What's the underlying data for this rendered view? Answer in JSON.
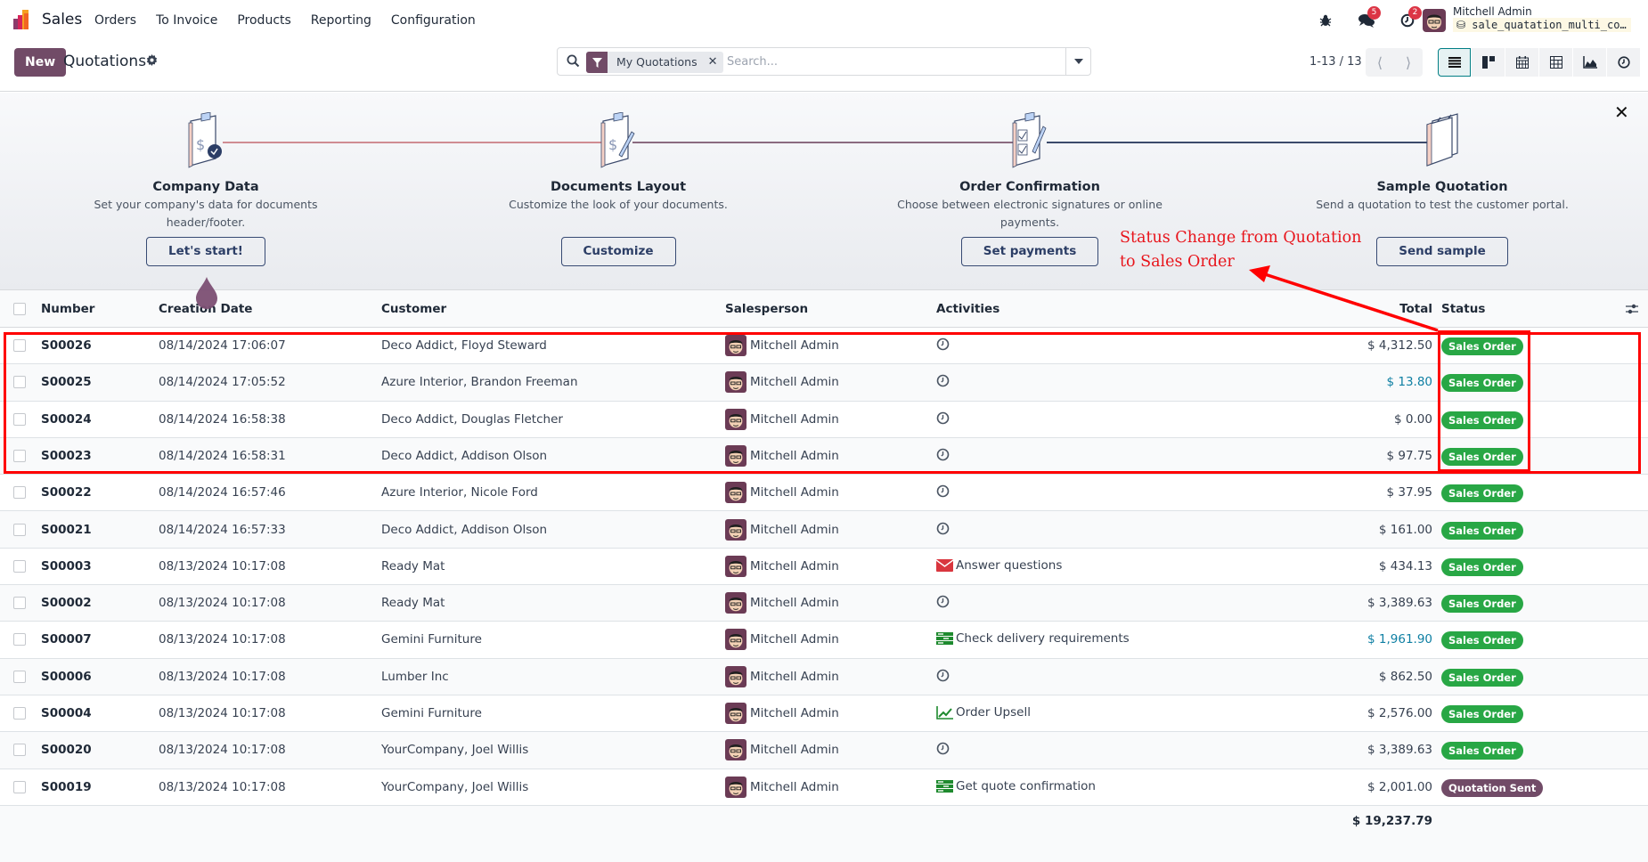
{
  "navbar": {
    "app_name": "Sales",
    "menu": [
      "Orders",
      "To Invoice",
      "Products",
      "Reporting",
      "Configuration"
    ],
    "messages_count": "5",
    "activities_count": "2",
    "user_name": "Mitchell Admin",
    "database": "sale_quatation_multi_con…"
  },
  "control": {
    "new_label": "New",
    "title": "Quotations",
    "facet_label": "My Quotations",
    "search_placeholder": "Search...",
    "pager": "1-13 / 13",
    "views": [
      "list-view",
      "kanban-view",
      "calendar-view",
      "pivot-view",
      "graph-view",
      "activity-view"
    ],
    "active_view": "list-view"
  },
  "banner": {
    "steps": [
      {
        "title": "Company Data",
        "desc": "Set your company's data for documents header/footer.",
        "button": "Let's start!"
      },
      {
        "title": "Documents Layout",
        "desc": "Customize the look of your documents.",
        "button": "Customize"
      },
      {
        "title": "Order Confirmation",
        "desc": "Choose between electronic signatures or online payments.",
        "button": "Set payments"
      },
      {
        "title": "Sample Quotation",
        "desc": "Send a quotation to test the customer portal.",
        "button": "Send sample"
      }
    ]
  },
  "table": {
    "columns": [
      "Number",
      "Creation Date",
      "Customer",
      "Salesperson",
      "Activities",
      "Total",
      "Status"
    ],
    "rows": [
      {
        "number": "S00026",
        "date": "08/14/2024 17:06:07",
        "customer": "Deco Addict, Floyd Steward",
        "salesperson": "Mitchell Admin",
        "activity": "",
        "activity_icon": "clock-icon",
        "total": "$ 4,312.50",
        "total_highlight": false,
        "status": "Sales Order"
      },
      {
        "number": "S00025",
        "date": "08/14/2024 17:05:52",
        "customer": "Azure Interior, Brandon Freeman",
        "salesperson": "Mitchell Admin",
        "activity": "",
        "activity_icon": "clock-icon",
        "total": "$ 13.80",
        "total_highlight": true,
        "status": "Sales Order"
      },
      {
        "number": "S00024",
        "date": "08/14/2024 16:58:38",
        "customer": "Deco Addict, Douglas Fletcher",
        "salesperson": "Mitchell Admin",
        "activity": "",
        "activity_icon": "clock-icon",
        "total": "$ 0.00",
        "total_highlight": false,
        "status": "Sales Order"
      },
      {
        "number": "S00023",
        "date": "08/14/2024 16:58:31",
        "customer": "Deco Addict, Addison Olson",
        "salesperson": "Mitchell Admin",
        "activity": "",
        "activity_icon": "clock-icon",
        "total": "$ 97.75",
        "total_highlight": false,
        "status": "Sales Order"
      },
      {
        "number": "S00022",
        "date": "08/14/2024 16:57:46",
        "customer": "Azure Interior, Nicole Ford",
        "salesperson": "Mitchell Admin",
        "activity": "",
        "activity_icon": "clock-icon",
        "total": "$ 37.95",
        "total_highlight": false,
        "status": "Sales Order"
      },
      {
        "number": "S00021",
        "date": "08/14/2024 16:57:33",
        "customer": "Deco Addict, Addison Olson",
        "salesperson": "Mitchell Admin",
        "activity": "",
        "activity_icon": "clock-icon",
        "total": "$ 161.00",
        "total_highlight": false,
        "status": "Sales Order"
      },
      {
        "number": "S00003",
        "date": "08/13/2024 10:17:08",
        "customer": "Ready Mat",
        "salesperson": "Mitchell Admin",
        "activity": "Answer questions",
        "activity_icon": "email-icon",
        "total": "$ 434.13",
        "total_highlight": false,
        "status": "Sales Order"
      },
      {
        "number": "S00002",
        "date": "08/13/2024 10:17:08",
        "customer": "Ready Mat",
        "salesperson": "Mitchell Admin",
        "activity": "",
        "activity_icon": "clock-icon",
        "total": "$ 3,389.63",
        "total_highlight": false,
        "status": "Sales Order"
      },
      {
        "number": "S00007",
        "date": "08/13/2024 10:17:08",
        "customer": "Gemini Furniture",
        "salesperson": "Mitchell Admin",
        "activity": "Check delivery requirements",
        "activity_icon": "tasks-icon",
        "total": "$ 1,961.90",
        "total_highlight": true,
        "status": "Sales Order"
      },
      {
        "number": "S00006",
        "date": "08/13/2024 10:17:08",
        "customer": "Lumber Inc",
        "salesperson": "Mitchell Admin",
        "activity": "",
        "activity_icon": "clock-icon",
        "total": "$ 862.50",
        "total_highlight": false,
        "status": "Sales Order"
      },
      {
        "number": "S00004",
        "date": "08/13/2024 10:17:08",
        "customer": "Gemini Furniture",
        "salesperson": "Mitchell Admin",
        "activity": "Order Upsell",
        "activity_icon": "chart-line-icon",
        "total": "$ 2,576.00",
        "total_highlight": false,
        "status": "Sales Order"
      },
      {
        "number": "S00020",
        "date": "08/13/2024 10:17:08",
        "customer": "YourCompany, Joel Willis",
        "salesperson": "Mitchell Admin",
        "activity": "",
        "activity_icon": "clock-icon",
        "total": "$ 3,389.63",
        "total_highlight": false,
        "status": "Sales Order"
      },
      {
        "number": "S00019",
        "date": "08/13/2024 10:17:08",
        "customer": "YourCompany, Joel Willis",
        "salesperson": "Mitchell Admin",
        "activity": "Get quote confirmation",
        "activity_icon": "tasks-icon",
        "total": "$ 2,001.00",
        "total_highlight": false,
        "status": "Quotation Sent"
      }
    ],
    "grand_total": "$ 19,237.79"
  },
  "status_colors": {
    "Sales Order": "#28a745",
    "Quotation Sent": "#714B67"
  },
  "colors": {
    "brand": "#714B67",
    "link_total": "#0e7fa3",
    "annotation": "#ff0000"
  },
  "annotation": {
    "text_line1": "Status Change from Quotation",
    "text_line2": "to Sales Order"
  }
}
